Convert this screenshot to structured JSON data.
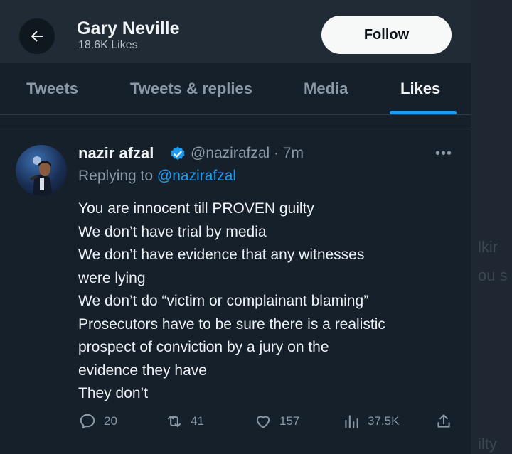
{
  "header": {
    "back_label": "←",
    "name": "Gary Neville",
    "subtitle": "18.6K Likes",
    "follow_label": "Follow"
  },
  "tabs": [
    {
      "label": "Tweets"
    },
    {
      "label": "Tweets & replies"
    },
    {
      "label": "Media"
    },
    {
      "label": "Likes",
      "active": true
    }
  ],
  "tweet": {
    "author_name": "nazir afzal",
    "handle_time": "@nazirafzal · 7m",
    "replying_prefix": "Replying to ",
    "replying_to": "@nazirafzal",
    "lines": [
      "You are innocent till PROVEN guilty",
      "We don’t have trial by media",
      "We don’t have evidence that any witnesses",
      "were lying",
      "We don’t do “victim or complainant blaming”",
      "Prosecutors have to be sure there is a realistic",
      "prospect of conviction by a jury on the",
      "evidence they have",
      "They don’t"
    ],
    "replies": "20",
    "retweets": "41",
    "likes": "157",
    "views": "37.5K"
  },
  "background_fragments": [
    "lkir",
    "ou s",
    "ilty"
  ],
  "colors": {
    "background": "#15202b",
    "accent": "#1d9bf0",
    "text_secondary": "#8b98a5"
  }
}
